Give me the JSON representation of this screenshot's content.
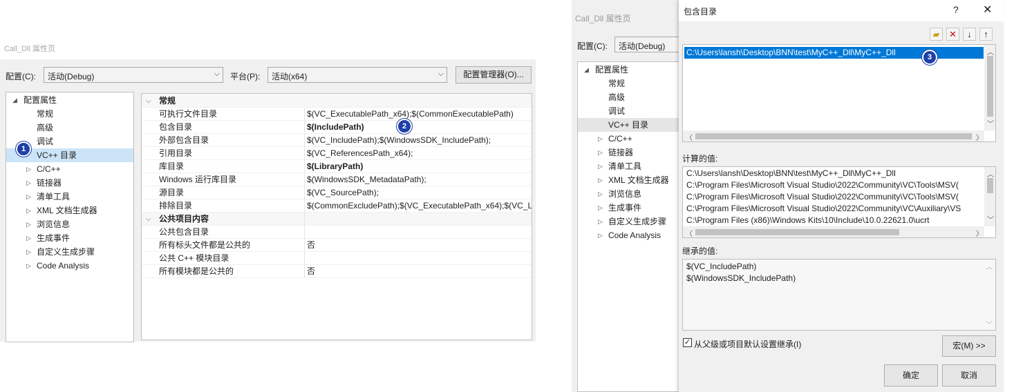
{
  "left": {
    "title": "Call_Dll 属性页",
    "title_controls": [
      "?",
      "×"
    ],
    "config_label": "配置(C):",
    "config_value": "活动(Debug)",
    "platform_label": "平台(P):",
    "platform_value": "活动(x64)",
    "config_manager_button": "配置管理器(O)...",
    "tree_root": "配置属性",
    "tree_items": [
      "常规",
      "高级",
      "调试",
      "VC++ 目录"
    ],
    "tree_expandable": [
      "C/C++",
      "链接器",
      "清单工具",
      "XML 文档生成器",
      "浏览信息",
      "生成事件",
      "自定义生成步骤",
      "Code Analysis"
    ],
    "badge1": "1",
    "section1": "常规",
    "rows1": [
      {
        "name": "可执行文件目录",
        "value": "$(VC_ExecutablePath_x64);$(CommonExecutablePath)"
      },
      {
        "name": "包含目录",
        "value": "$(IncludePath)"
      },
      {
        "name": "外部包含目录",
        "value": "$(VC_IncludePath);$(WindowsSDK_IncludePath);"
      },
      {
        "name": "引用目录",
        "value": "$(VC_ReferencesPath_x64);"
      },
      {
        "name": "库目录",
        "value": "$(LibraryPath)"
      },
      {
        "name": "Windows 运行库目录",
        "value": "$(WindowsSDK_MetadataPath);"
      },
      {
        "name": "源目录",
        "value": "$(VC_SourcePath);"
      },
      {
        "name": "排除目录",
        "value": "$(CommonExcludePath);$(VC_ExecutablePath_x64);$(VC_L"
      }
    ],
    "badge2": "2",
    "section2": "公共项目内容",
    "rows2": [
      {
        "name": "公共包含目录",
        "value": ""
      },
      {
        "name": "所有标头文件都是公共的",
        "value": "否"
      },
      {
        "name": "公共 C++ 模块目录",
        "value": ""
      },
      {
        "name": "所有模块都是公共的",
        "value": "否"
      }
    ]
  },
  "back": {
    "title": "Call_Dll 属性页",
    "config_label": "配置(C):",
    "config_value": "活动(Debug)",
    "tree_root": "配置属性",
    "tree_items": [
      "常规",
      "高级",
      "调试",
      "VC++ 目录"
    ],
    "tree_expandable": [
      "C/C++",
      "链接器",
      "清单工具",
      "XML 文档生成器",
      "浏览信息",
      "生成事件",
      "自定义生成步骤",
      "Code Analysis"
    ]
  },
  "right": {
    "title": "包含目录",
    "help": "?",
    "close": "✕",
    "toolbar_icons": [
      "new-folder-icon",
      "delete-icon",
      "move-down-icon",
      "move-up-icon"
    ],
    "selected_path": "C:\\Users\\lansh\\Desktop\\BNN\\test\\MyC++_Dll\\MyC++_Dll",
    "badge3": "3",
    "computed_label": "计算的值:",
    "computed_values": [
      "C:\\Users\\lansh\\Desktop\\BNN\\test\\MyC++_Dll\\MyC++_Dll",
      "C:\\Program Files\\Microsoft Visual Studio\\2022\\Community\\VC\\Tools\\MSV(",
      "C:\\Program Files\\Microsoft Visual Studio\\2022\\Community\\VC\\Tools\\MSV(",
      "C:\\Program Files\\Microsoft Visual Studio\\2022\\Community\\VC\\Auxiliary\\VS",
      "C:\\Program Files (x86)\\Windows Kits\\10\\Include\\10.0.22621.0\\ucrt"
    ],
    "inherited_label": "继承的值:",
    "inherited_values": [
      "$(VC_IncludePath)",
      "$(WindowsSDK_IncludePath)"
    ],
    "inherit_checkbox": "从父级或项目默认设置继承(I)",
    "inherit_checked": true,
    "macro_button": "宏(M) >>",
    "ok_button": "确定",
    "cancel_button": "取消"
  },
  "colors": {
    "badge": "#1e40a8",
    "selection": "#0078d7",
    "tree_selection": "#cce4f7"
  }
}
